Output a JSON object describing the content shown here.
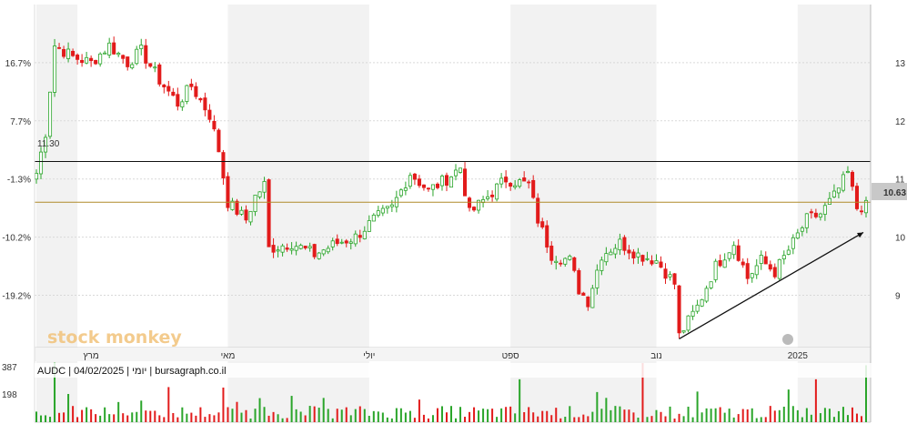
{
  "chart_data": {
    "type": "candlestick",
    "symbol_line": "AUDC | 04/02/2025 | יומי | bursagraph.co.il",
    "watermark": "stock monkey",
    "price_axis": {
      "min": 8.1,
      "max": 14.0,
      "ticks": [
        9,
        10,
        11,
        12,
        13
      ]
    },
    "percent_axis": {
      "ticks": [
        "16.7%",
        "7.7%",
        "-1.3%",
        "-10.2%",
        "-19.2%"
      ],
      "tick_prices": [
        13.0,
        12.0,
        11.0,
        10.0,
        9.0
      ]
    },
    "last_price_label": "10.63",
    "last_price": 10.63,
    "resistance_label": "11.30",
    "resistance_price": 11.3,
    "reference_price": 10.6,
    "x_labels": [
      {
        "text": "מרץ",
        "index": 12
      },
      {
        "text": "מאי",
        "index": 42
      },
      {
        "text": "יולי",
        "index": 73
      },
      {
        "text": "ספט",
        "index": 104
      },
      {
        "text": "נוב",
        "index": 136
      },
      {
        "text": "2025",
        "index": 167
      }
    ],
    "shade_bands": [
      [
        0,
        9
      ],
      [
        42,
        73
      ],
      [
        104,
        136
      ],
      [
        167,
        183
      ]
    ],
    "n_candles": 183,
    "price_anchors": [
      [
        0,
        11.1
      ],
      [
        2,
        11.8
      ],
      [
        4,
        13.3
      ],
      [
        8,
        13.1
      ],
      [
        12,
        13.0
      ],
      [
        16,
        13.3
      ],
      [
        20,
        13.0
      ],
      [
        23,
        13.2
      ],
      [
        27,
        12.7
      ],
      [
        31,
        12.3
      ],
      [
        34,
        12.6
      ],
      [
        38,
        12.1
      ],
      [
        40,
        11.5
      ],
      [
        42,
        10.6
      ],
      [
        46,
        10.3
      ],
      [
        48,
        10.7
      ],
      [
        50,
        10.9
      ],
      [
        51,
        9.8
      ],
      [
        56,
        9.9
      ],
      [
        61,
        9.7
      ],
      [
        66,
        9.9
      ],
      [
        70,
        10.0
      ],
      [
        74,
        10.3
      ],
      [
        78,
        10.5
      ],
      [
        82,
        11.1
      ],
      [
        86,
        10.8
      ],
      [
        90,
        11.0
      ],
      [
        93,
        11.2
      ],
      [
        95,
        10.4
      ],
      [
        99,
        10.7
      ],
      [
        103,
        11.0
      ],
      [
        108,
        10.9
      ],
      [
        110,
        10.3
      ],
      [
        113,
        9.7
      ],
      [
        117,
        9.6
      ],
      [
        119,
        9.1
      ],
      [
        121,
        8.9
      ],
      [
        124,
        9.7
      ],
      [
        128,
        9.9
      ],
      [
        132,
        9.7
      ],
      [
        136,
        9.6
      ],
      [
        140,
        9.2
      ],
      [
        141,
        8.3
      ],
      [
        145,
        8.8
      ],
      [
        149,
        9.5
      ],
      [
        153,
        9.9
      ],
      [
        156,
        9.3
      ],
      [
        159,
        9.6
      ],
      [
        162,
        9.4
      ],
      [
        166,
        9.9
      ],
      [
        169,
        10.3
      ],
      [
        172,
        10.4
      ],
      [
        175,
        10.7
      ],
      [
        178,
        11.1
      ],
      [
        180,
        10.5
      ],
      [
        183,
        10.6
      ]
    ],
    "volume_axis": {
      "ticks": [
        387,
        198
      ],
      "max": 420
    }
  },
  "trendline": {
    "from_index": 141,
    "from_price": 8.25,
    "to_index": 183,
    "to_price": 10.08
  }
}
